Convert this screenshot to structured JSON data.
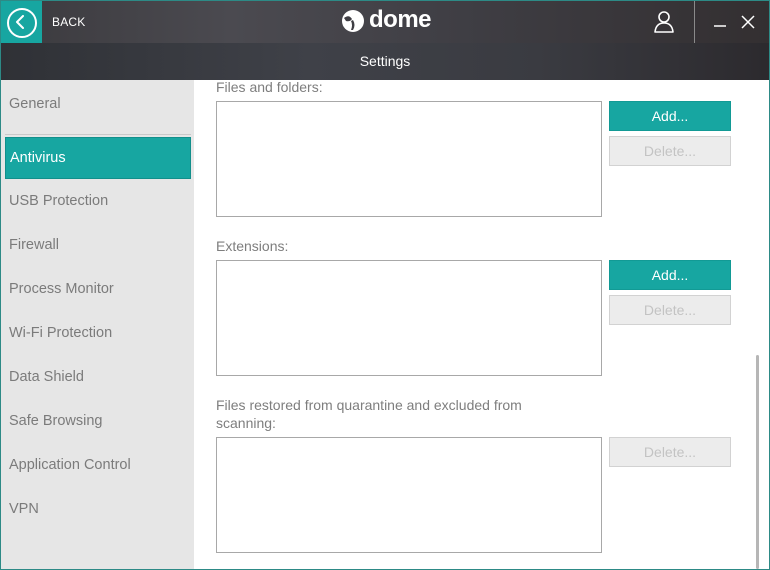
{
  "header": {
    "back_label": "BACK",
    "brand_name": "dome",
    "subtitle": "Settings"
  },
  "sidebar": {
    "items": [
      {
        "label": "General"
      },
      {
        "label": "Antivirus",
        "active": true
      },
      {
        "label": "USB Protection"
      },
      {
        "label": "Firewall"
      },
      {
        "label": "Process Monitor"
      },
      {
        "label": "Wi-Fi Protection"
      },
      {
        "label": "Data Shield"
      },
      {
        "label": "Safe Browsing"
      },
      {
        "label": "Application Control"
      },
      {
        "label": "VPN"
      }
    ]
  },
  "main": {
    "files_folders": {
      "label": "Files and folders:",
      "add": "Add...",
      "delete": "Delete..."
    },
    "extensions": {
      "label": "Extensions:",
      "add": "Add...",
      "delete": "Delete..."
    },
    "restored": {
      "label": "Files restored from quarantine and excluded from scanning:",
      "delete": "Delete..."
    }
  },
  "colors": {
    "accent": "#17a6a1",
    "sidebar_bg": "#e6e6e6",
    "disabled_button": "#ececec"
  },
  "icons": [
    "back-arrow-icon",
    "dome-logo-icon",
    "user-icon",
    "minimize-icon",
    "close-icon"
  ]
}
